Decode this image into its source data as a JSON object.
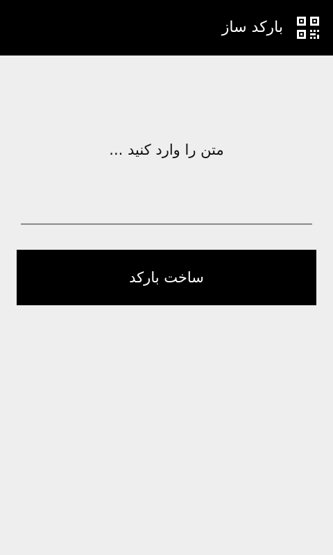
{
  "app_bar": {
    "title": "بارکد ساز",
    "icon": "qr-code-icon",
    "background_color": "#000000",
    "text_color": "#ffffff"
  },
  "main": {
    "prompt": "متن را وارد کنید ...",
    "input_value": "",
    "input_placeholder": "",
    "build_button_label": "ساخت بارکد",
    "background_color": "#eeeeee"
  }
}
